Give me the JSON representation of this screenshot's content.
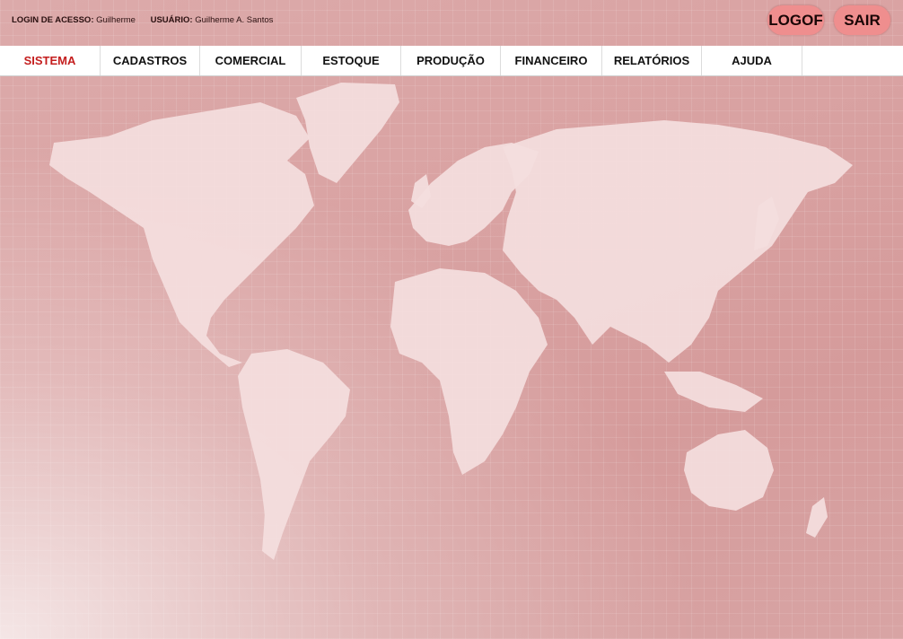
{
  "header": {
    "login_label": "LOGIN DE ACESSO:",
    "login_value": "Guilherme",
    "user_label": "USUÁRIO:",
    "user_value": "Guilherme A. Santos",
    "logof_label": "LOGOF",
    "sair_label": "SAIR"
  },
  "menu": {
    "items": [
      {
        "label": "SISTEMA"
      },
      {
        "label": "CADASTROS"
      },
      {
        "label": "COMERCIAL"
      },
      {
        "label": "ESTOQUE"
      },
      {
        "label": "PRODUÇÃO"
      },
      {
        "label": "FINANCEIRO"
      },
      {
        "label": "RELATÓRIOS"
      },
      {
        "label": "AJUDA"
      }
    ]
  },
  "colors": {
    "active_menu": "#c41e1e",
    "pill": "#ef8e8e",
    "background": "#d49a9a"
  }
}
